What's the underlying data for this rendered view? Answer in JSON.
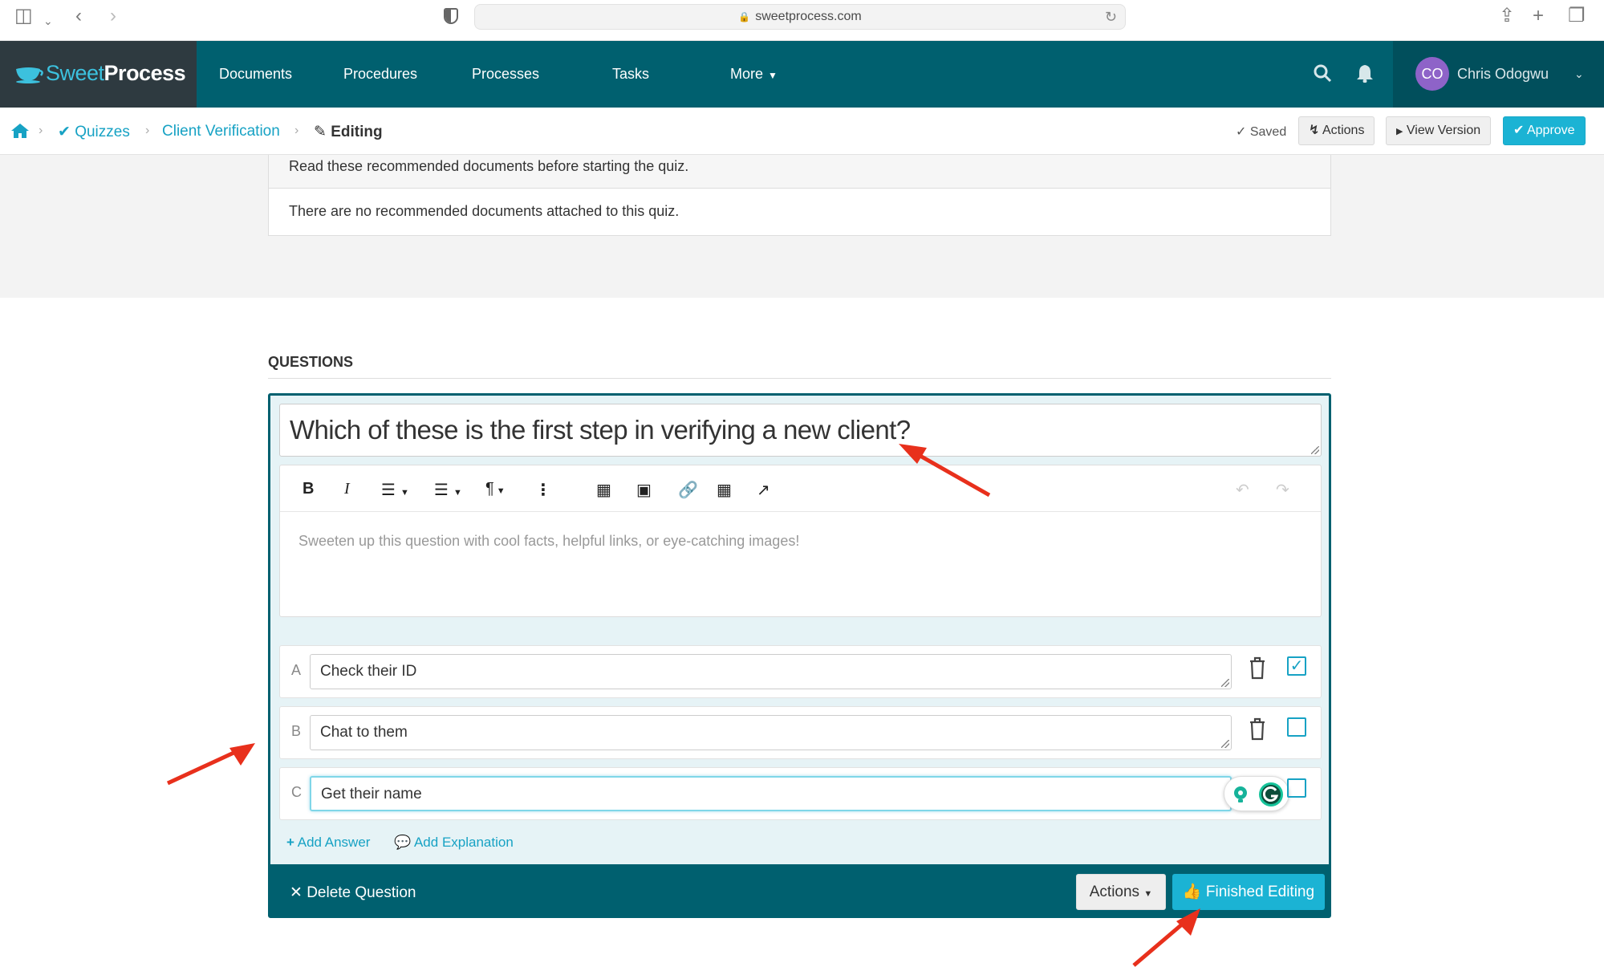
{
  "browser": {
    "url": "sweetprocess.com"
  },
  "nav": {
    "logo_sweet": "Sweet",
    "logo_process": "Process",
    "items": [
      {
        "label": "Documents"
      },
      {
        "label": "Procedures"
      },
      {
        "label": "Processes"
      },
      {
        "label": "Tasks"
      },
      {
        "label": "More"
      }
    ],
    "user": {
      "initials": "CO",
      "name": "Chris Odogwu"
    }
  },
  "breadcrumb": {
    "items": [
      {
        "label": "Quizzes"
      },
      {
        "label": "Client Verification"
      },
      {
        "label": "Editing"
      }
    ],
    "saved": "Saved",
    "actions_label": "Actions",
    "view_version_label": "View Version",
    "approve_label": "Approve"
  },
  "recommended": {
    "header": "Read these recommended documents before starting the quiz.",
    "empty": "There are no recommended documents attached to this quiz."
  },
  "questions": {
    "heading": "QUESTIONS",
    "question_text": "Which of these is the first step in verifying a new client?",
    "editor_placeholder": "Sweeten up this question with cool facts, helpful links, or eye-catching images!",
    "answers": [
      {
        "letter": "A",
        "text": "Check their ID",
        "correct": true
      },
      {
        "letter": "B",
        "text": "Chat to them",
        "correct": false
      },
      {
        "letter": "C",
        "text": "Get their name",
        "correct": false
      }
    ],
    "add_answer": "Add Answer",
    "add_explanation": "Add Explanation",
    "delete_question": "Delete Question",
    "footer_actions": "Actions",
    "finished_editing": "Finished Editing"
  },
  "colors": {
    "nav_bg": "#00606f",
    "accent": "#1bb3d4",
    "annotation_arrow": "#e8301c"
  }
}
